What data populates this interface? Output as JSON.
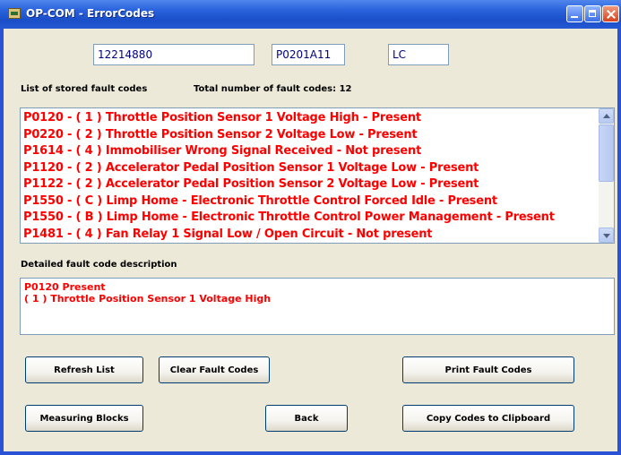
{
  "window": {
    "title": "OP-COM - ErrorCodes",
    "controls": [
      "minimize",
      "maximize",
      "close"
    ]
  },
  "fields": {
    "id1": "12214880",
    "id2": "P0201A11",
    "id3": "LC"
  },
  "list": {
    "label": "List of stored fault codes",
    "total_label": "Total number of fault codes: 12",
    "items": [
      "P0120 - ( 1 )  Throttle Position Sensor 1 Voltage High - Present",
      "P0220 - ( 2 )  Throttle Position Sensor 2 Voltage Low - Present",
      "P1614 - ( 4 )  Immobiliser Wrong Signal Received - Not present",
      "P1120 - ( 2 )  Accelerator Pedal Position Sensor 1 Voltage Low - Present",
      "P1122 - ( 2 )  Accelerator Pedal Position Sensor 2 Voltage Low - Present",
      "P1550 - ( C )  Limp Home - Electronic Throttle Control Forced Idle - Present",
      "P1550 - ( B )  Limp Home - Electronic Throttle Control Power Management - Present",
      "P1481 - ( 4 )  Fan Relay 1 Signal Low / Open Circuit - Not present"
    ]
  },
  "description": {
    "label": "Detailed fault code description",
    "lines": [
      "P0120  Present",
      "( 1 )  Throttle Position Sensor 1 Voltage High"
    ]
  },
  "buttons": {
    "refresh": "Refresh List",
    "clear": "Clear Fault Codes",
    "print": "Print Fault Codes",
    "measuring": "Measuring Blocks",
    "back": "Back",
    "copy": "Copy Codes to Clipboard"
  },
  "colors": {
    "fault_text": "#ff0000",
    "title_bar": "#2a63dd",
    "client_bg": "#ece9d8"
  }
}
